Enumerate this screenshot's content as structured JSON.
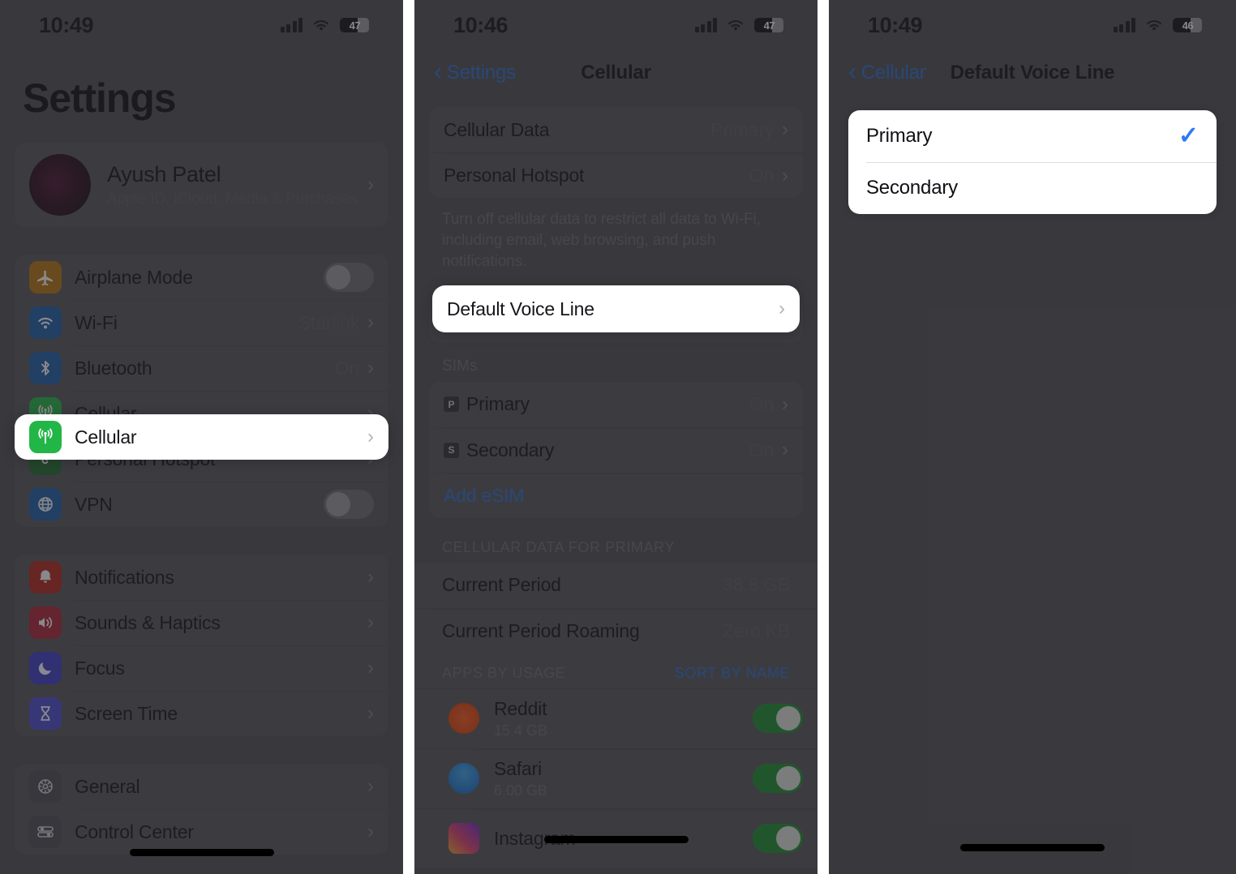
{
  "panels": [
    {
      "id": "settings-root",
      "status": {
        "time": "10:49",
        "battery": "47",
        "wifi_icon": "wifi-icon",
        "signal_icon": "cellular-signal-icon"
      },
      "title": "Settings",
      "account": {
        "name": "Ayush Patel",
        "subtitle": "Apple ID, iCloud, Media & Purchases",
        "chevron": "›"
      },
      "group_connectivity": [
        {
          "label": "Airplane Mode",
          "icon": "airplane-icon",
          "icon_color": "#b5730f",
          "control": "toggle",
          "toggle_on": false
        },
        {
          "label": "Wi-Fi",
          "icon": "wifi-icon",
          "icon_color": "#1c5ca8",
          "value": "Starlink",
          "control": "chevron"
        },
        {
          "label": "Bluetooth",
          "icon": "bluetooth-icon",
          "icon_color": "#1c5ca8",
          "value": "On",
          "control": "chevron"
        },
        {
          "label": "Cellular",
          "icon": "cellular-icon",
          "icon_color": "#22b647",
          "control": "chevron",
          "highlighted": true
        },
        {
          "label": "Personal Hotspot",
          "icon": "hotspot-icon",
          "icon_color": "#1d6b2e",
          "control": "chevron"
        },
        {
          "label": "VPN",
          "icon": "vpn-icon",
          "icon_color": "#1c5ca8",
          "control": "toggle",
          "toggle_on": false
        }
      ],
      "group_alerts": [
        {
          "label": "Notifications",
          "icon": "notifications-bell-icon",
          "icon_color": "#b32319",
          "control": "chevron"
        },
        {
          "label": "Sounds & Haptics",
          "icon": "sounds-speaker-icon",
          "icon_color": "#ad1f36",
          "control": "chevron"
        },
        {
          "label": "Focus",
          "icon": "focus-moon-icon",
          "icon_color": "#3b3acb",
          "control": "chevron"
        },
        {
          "label": "Screen Time",
          "icon": "screen-time-hourglass-icon",
          "icon_color": "#4a49d6",
          "control": "chevron"
        }
      ],
      "group_system": [
        {
          "label": "General",
          "icon": "general-gear-icon",
          "icon_color": "#4b4b52",
          "control": "chevron"
        },
        {
          "label": "Control Center",
          "icon": "control-center-icon",
          "icon_color": "#4b4b52",
          "control": "chevron"
        }
      ]
    },
    {
      "id": "cellular",
      "status": {
        "time": "10:46",
        "battery": "47"
      },
      "nav": {
        "back_label": "Settings",
        "back_chevron": "‹",
        "title": "Cellular"
      },
      "group_data": [
        {
          "label": "Cellular Data",
          "value": "Primary",
          "chevron": "›"
        },
        {
          "label": "Personal Hotspot",
          "value": "On",
          "chevron": "›"
        }
      ],
      "data_note": "Turn off cellular data to restrict all data to Wi-Fi, including email, web browsing, and push notifications.",
      "voice_line_row": {
        "label": "Default Voice Line",
        "chevron": "›",
        "highlighted": true
      },
      "sims_header": "SIMs",
      "sims": [
        {
          "tag": "P",
          "label": "Primary",
          "value": "On",
          "chevron": "›"
        },
        {
          "tag": "S",
          "label": "Secondary",
          "value": "On",
          "chevron": "›"
        }
      ],
      "add_esim_label": "Add eSIM",
      "usage_header": "CELLULAR DATA FOR PRIMARY",
      "usage_rows": [
        {
          "label": "Current Period",
          "value": "38.8 GB"
        },
        {
          "label": "Current Period Roaming",
          "value": "Zero KB"
        }
      ],
      "apps_header": "APPS BY USAGE",
      "apps_sort_link": "SORT BY NAME",
      "apps": [
        {
          "name": "Reddit",
          "size": "15.4 GB",
          "icon": "reddit-icon",
          "toggle_on": true
        },
        {
          "name": "Safari",
          "size": "6.00 GB",
          "icon": "safari-icon",
          "toggle_on": true
        },
        {
          "name": "Instagram",
          "size": "",
          "icon": "instagram-icon",
          "toggle_on": true
        }
      ]
    },
    {
      "id": "default-voice-line",
      "status": {
        "time": "10:49",
        "battery": "46"
      },
      "nav": {
        "back_label": "Cellular",
        "back_chevron": "‹",
        "title": "Default Voice Line"
      },
      "choices": [
        {
          "label": "Primary",
          "selected": true,
          "check": "✓"
        },
        {
          "label": "Secondary",
          "selected": false,
          "check": ""
        }
      ]
    }
  ],
  "colors": {
    "accent_blue": "#2b6fd6",
    "check_blue": "#2b7cf0",
    "toggle_on_green": "#1a8f2e",
    "spotlight_white": "#ffffff",
    "dim_overlay": "rgba(40,40,44,0.55)"
  }
}
